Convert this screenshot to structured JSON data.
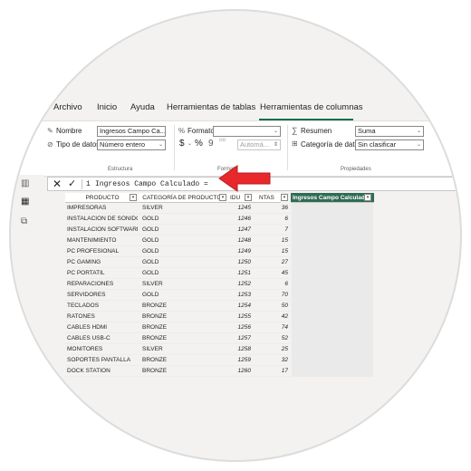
{
  "tabs": [
    {
      "label": "Archivo"
    },
    {
      "label": "Inicio"
    },
    {
      "label": "Ayuda"
    },
    {
      "label": "Herramientas de tablas"
    },
    {
      "label": "Herramientas de columnas"
    }
  ],
  "ribbon": {
    "estructura": {
      "nombre_label": "Nombre",
      "nombre_value": "Ingresos Campo Ca...",
      "tipo_label": "Tipo de datos",
      "tipo_value": "Número entero",
      "group_label": "Estructura"
    },
    "formato": {
      "formato_label": "Formato",
      "formato_value": "",
      "currency_symbol": "$",
      "percent_symbol": "%",
      "comma_symbol": "9",
      "decimals_symbol": "⁰⁰",
      "auto_value": "Automá...",
      "group_label": "Formato"
    },
    "propiedades": {
      "resumen_label": "Resumen",
      "resumen_value": "Suma",
      "categoria_label": "Categoría de datos",
      "categoria_value": "Sin clasificar",
      "group_label": "Propiedades"
    }
  },
  "formula": {
    "line_number": "1",
    "text": "Ingresos Campo Calculado ="
  },
  "table": {
    "headers": {
      "producto": "PRODUCTO",
      "categoria": "CATEGORÍA DE PRODUCTOS",
      "idu": "IDU",
      "ventas": "NTAS",
      "ingresos": "Ingresos Campo Calculado"
    },
    "rows": [
      {
        "producto": "IMPRESORAS",
        "categoria": "SILVER",
        "idu": "1245",
        "ventas": "36"
      },
      {
        "producto": "INSTALACION DE SONIDO",
        "categoria": "GOLD",
        "idu": "1246",
        "ventas": "6"
      },
      {
        "producto": "INSTALACION SOFTWARE",
        "categoria": "GOLD",
        "idu": "1247",
        "ventas": "7"
      },
      {
        "producto": "MANTENIMIENTO",
        "categoria": "GOLD",
        "idu": "1248",
        "ventas": "15"
      },
      {
        "producto": "PC PROFESIONAL",
        "categoria": "GOLD",
        "idu": "1249",
        "ventas": "15"
      },
      {
        "producto": "PC GAMING",
        "categoria": "GOLD",
        "idu": "1250",
        "ventas": "27"
      },
      {
        "producto": "PC PORTATIL",
        "categoria": "GOLD",
        "idu": "1251",
        "ventas": "45"
      },
      {
        "producto": "REPARACIONES",
        "categoria": "SILVER",
        "idu": "1252",
        "ventas": "6"
      },
      {
        "producto": "SERVIDORES",
        "categoria": "GOLD",
        "idu": "1253",
        "ventas": "70"
      },
      {
        "producto": "TECLADOS",
        "categoria": "BRONZE",
        "idu": "1254",
        "ventas": "50"
      },
      {
        "producto": "RATONES",
        "categoria": "BRONZE",
        "idu": "1255",
        "ventas": "42"
      },
      {
        "producto": "CABLES HDMI",
        "categoria": "BRONZE",
        "idu": "1256",
        "ventas": "74"
      },
      {
        "producto": "CABLES USB-C",
        "categoria": "BRONZE",
        "idu": "1257",
        "ventas": "52"
      },
      {
        "producto": "MONITORES",
        "categoria": "SILVER",
        "idu": "1258",
        "ventas": "25"
      },
      {
        "producto": "SOPORTES PANTALLA",
        "categoria": "BRONZE",
        "idu": "1259",
        "ventas": "32"
      },
      {
        "producto": "DOCK STATION",
        "categoria": "BRONZE",
        "idu": "1260",
        "ventas": "17"
      }
    ]
  },
  "colors": {
    "accent_green": "#1b6e4b",
    "header_highlight": "#2f6b55",
    "arrow_red": "#e8282b"
  }
}
